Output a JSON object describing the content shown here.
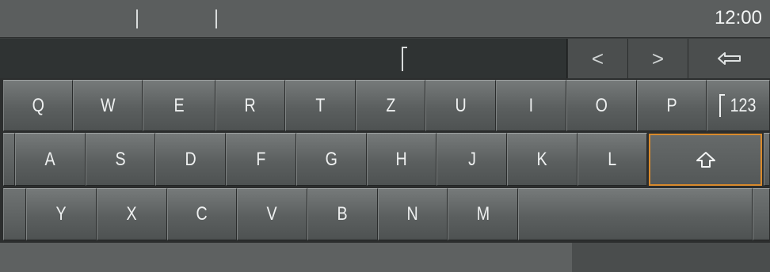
{
  "status_bar": {
    "time": "12:00"
  },
  "input": {
    "nav_prev": "<",
    "nav_next": ">"
  },
  "keyboard": {
    "row1": [
      "Q",
      "W",
      "E",
      "R",
      "T",
      "Z",
      "U",
      "I",
      "O",
      "P"
    ],
    "row2": [
      "A",
      "S",
      "D",
      "F",
      "G",
      "H",
      "J",
      "K",
      "L"
    ],
    "row3": [
      "Y",
      "X",
      "C",
      "V",
      "B",
      "N",
      "M"
    ],
    "numbers_key_label": "123",
    "icons": {
      "shift": "shift-arrow-icon",
      "backspace": "backspace-arrow-icon",
      "cursor": "text-cursor-icon"
    },
    "focus_color": "#d98a2c"
  }
}
